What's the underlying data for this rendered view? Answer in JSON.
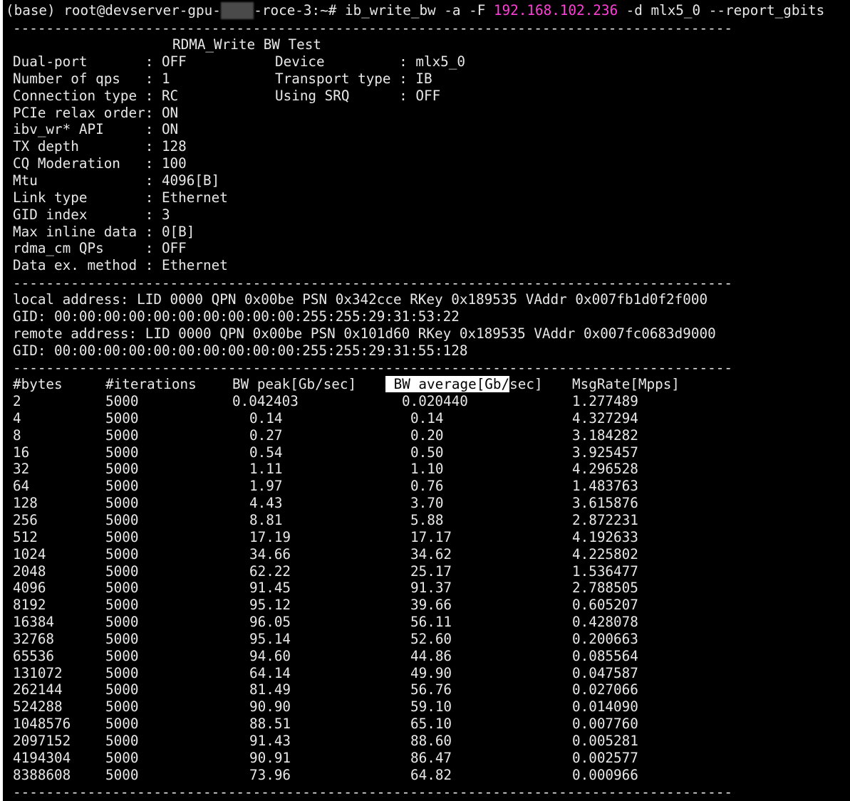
{
  "prompt": {
    "prefix": "(base) root@devserver-gpu-",
    "redacted": "xxxx",
    "suffix": "-roce-3:~# ",
    "command": "ib_write_bw -a -F ",
    "ip": "192.168.102.236",
    "args": " -d mlx5_0 --report_gbits"
  },
  "separator": "---------------------------------------------------------------------------------------",
  "test_title": "RDMA_Write BW Test",
  "settings_left": [
    {
      "label": "Dual-port      ",
      "value": "OFF"
    },
    {
      "label": "Number of qps  ",
      "value": "1"
    },
    {
      "label": "Connection type",
      "value": "RC"
    },
    {
      "label": "PCIe relax order",
      "value": "ON"
    },
    {
      "label": "ibv_wr* API    ",
      "value": "ON"
    },
    {
      "label": "TX depth       ",
      "value": "128"
    },
    {
      "label": "CQ Moderation  ",
      "value": "100"
    },
    {
      "label": "Mtu            ",
      "value": "4096[B]"
    },
    {
      "label": "Link type      ",
      "value": "Ethernet"
    },
    {
      "label": "GID index      ",
      "value": "3"
    },
    {
      "label": "Max inline data",
      "value": "0[B]"
    },
    {
      "label": "rdma_cm QPs    ",
      "value": "OFF"
    },
    {
      "label": "Data ex. method",
      "value": "Ethernet"
    }
  ],
  "settings_right": [
    {
      "label": "Device        ",
      "value": "mlx5_0"
    },
    {
      "label": "Transport type",
      "value": "IB"
    },
    {
      "label": "Using SRQ     ",
      "value": "OFF"
    }
  ],
  "addresses": [
    "local address: LID 0000 QPN 0x00be PSN 0x342cce RKey 0x189535 VAddr 0x007fb1d0f2f000",
    "GID: 00:00:00:00:00:00:00:00:00:00:255:255:29:31:53:22",
    "remote address: LID 0000 QPN 0x00be PSN 0x101d60 RKey 0x189535 VAddr 0x007fc0683d9000",
    "GID: 00:00:00:00:00:00:00:00:00:00:255:255:29:31:55:128"
  ],
  "table": {
    "headers": {
      "bytes": "#bytes",
      "iterations": "#iterations",
      "bw_peak": "BW peak[Gb/sec]",
      "bw_avg_a": "BW average[Gb/",
      "bw_avg_b": "sec]",
      "msg_rate": "MsgRate[Mpps]"
    },
    "rows": [
      [
        "2",
        "5000",
        "0.042403",
        "0.020440",
        "1.277489"
      ],
      [
        "4",
        "5000",
        "0.14",
        "0.14",
        "4.327294"
      ],
      [
        "8",
        "5000",
        "0.27",
        "0.20",
        "3.184282"
      ],
      [
        "16",
        "5000",
        "0.54",
        "0.50",
        "3.925457"
      ],
      [
        "32",
        "5000",
        "1.11",
        "1.10",
        "4.296528"
      ],
      [
        "64",
        "5000",
        "1.97",
        "0.76",
        "1.483763"
      ],
      [
        "128",
        "5000",
        "4.43",
        "3.70",
        "3.615876"
      ],
      [
        "256",
        "5000",
        "8.81",
        "5.88",
        "2.872231"
      ],
      [
        "512",
        "5000",
        "17.19",
        "17.17",
        "4.192633"
      ],
      [
        "1024",
        "5000",
        "34.66",
        "34.62",
        "4.225802"
      ],
      [
        "2048",
        "5000",
        "62.22",
        "25.17",
        "1.536477"
      ],
      [
        "4096",
        "5000",
        "91.45",
        "91.37",
        "2.788505"
      ],
      [
        "8192",
        "5000",
        "95.12",
        "39.66",
        "0.605207"
      ],
      [
        "16384",
        "5000",
        "96.05",
        "56.11",
        "0.428078"
      ],
      [
        "32768",
        "5000",
        "95.14",
        "52.60",
        "0.200663"
      ],
      [
        "65536",
        "5000",
        "94.60",
        "44.86",
        "0.085564"
      ],
      [
        "131072",
        "5000",
        "64.14",
        "49.90",
        "0.047587"
      ],
      [
        "262144",
        "5000",
        "81.49",
        "56.76",
        "0.027066"
      ],
      [
        "524288",
        "5000",
        "90.90",
        "59.10",
        "0.014090"
      ],
      [
        "1048576",
        "5000",
        "88.51",
        "65.10",
        "0.007760"
      ],
      [
        "2097152",
        "5000",
        "91.43",
        "88.60",
        "0.005281"
      ],
      [
        "4194304",
        "5000",
        "90.91",
        "86.47",
        "0.002577"
      ],
      [
        "8388608",
        "5000",
        "73.96",
        "64.82",
        "0.000966"
      ]
    ]
  },
  "colors": {
    "background": "#000000",
    "foreground": "#e8e8e8",
    "ip_highlight": "#ff3fd8",
    "selection_bg": "#ffffff"
  }
}
